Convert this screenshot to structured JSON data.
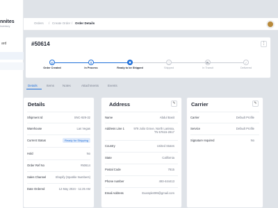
{
  "app": {
    "brand": "nnites",
    "brand_sub": "Inventory"
  },
  "sidebar": {
    "items": [
      {
        "label": "ard"
      }
    ]
  },
  "breadcrumb": [
    "Orders",
    "/",
    "Create Order",
    "/",
    "Order Details"
  ],
  "order": {
    "number": "#50614"
  },
  "tracking": {
    "steps": [
      {
        "label": "Order Created",
        "icon": "document-icon",
        "state": "done"
      },
      {
        "label": "In Process",
        "icon": "hourglass-icon",
        "state": "done"
      },
      {
        "label": "Ready to be Shipped",
        "icon": "box-icon",
        "state": "current"
      },
      {
        "label": "Shipped",
        "icon": "box-icon",
        "state": "todo"
      },
      {
        "label": "In Transit",
        "icon": "truck-icon",
        "state": "todo"
      },
      {
        "label": "Delivered",
        "icon": "check-icon",
        "state": "todo"
      }
    ]
  },
  "tabs": [
    "Details",
    "Items",
    "Notes",
    "Attachments",
    "Events"
  ],
  "details": {
    "title": "Details",
    "rows": [
      {
        "label": "Shipment Id",
        "value": "SNC-929-32"
      },
      {
        "label": "Warehouse",
        "value": "Las Vegas"
      },
      {
        "label": "Current Status",
        "value": "Ready for Shipping"
      },
      {
        "label": "Hold",
        "value": "No"
      },
      {
        "label": "Order Ref No",
        "value": "#50614"
      },
      {
        "label": "Sales Channel",
        "value": "Shopify (Sparkle Numbers)"
      },
      {
        "label": "Date Ordered",
        "value": "12 May 2024 - 11:25 AM"
      }
    ]
  },
  "address": {
    "title": "Address",
    "rows": [
      {
        "label": "Name",
        "value": "Abdul Basit"
      },
      {
        "label": "Address Line 1",
        "value": "979 Julio Grove, North Lanissa, TN 57615-2817"
      },
      {
        "label": "Country",
        "value": "United States"
      },
      {
        "label": "State",
        "value": "California"
      },
      {
        "label": "Postal Code",
        "value": "7815"
      },
      {
        "label": "Phone number",
        "value": "493-444413"
      },
      {
        "label": "Email Address",
        "value": "Example099@gmail.com"
      }
    ]
  },
  "carrier": {
    "title": "Carrier",
    "rows": [
      {
        "label": "Carrier",
        "value": "Default Profile"
      },
      {
        "label": "Service",
        "value": "Default Profile"
      },
      {
        "label": "Signature required",
        "value": "No"
      }
    ]
  },
  "colors": {
    "accent": "#1e6fd9",
    "muted": "#c9ccd3"
  }
}
